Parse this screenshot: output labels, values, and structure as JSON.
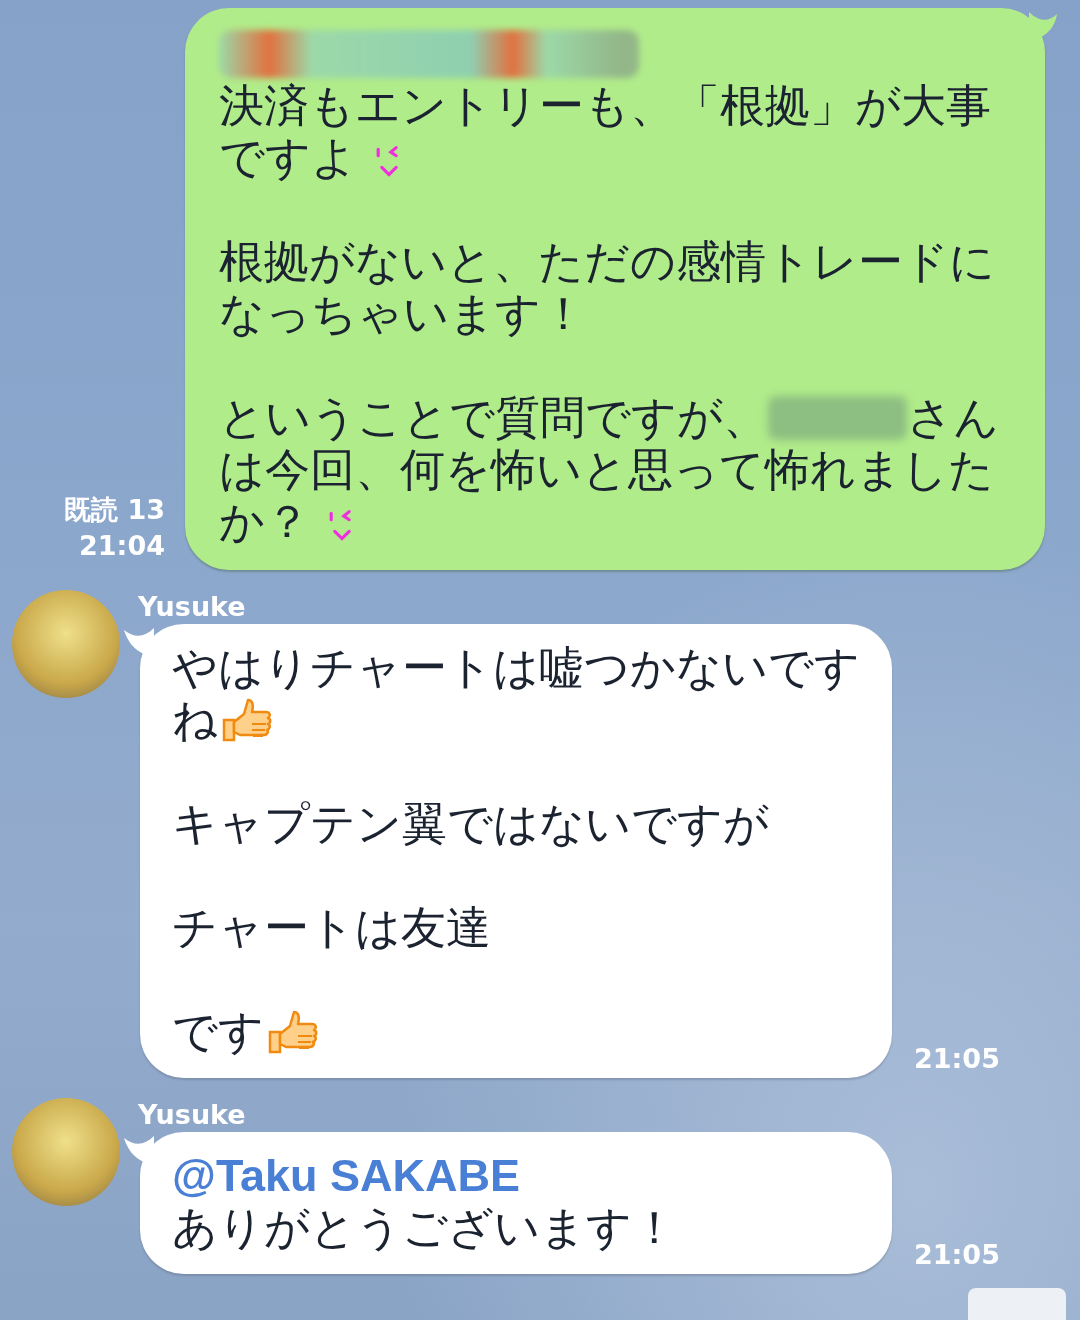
{
  "messages": [
    {
      "kind": "outgoing",
      "read": "既読 13",
      "time": "21:04",
      "paragraphs": [
        [
          [
            {
              "kind": "blurred_line"
            }
          ],
          [
            {
              "kind": "text",
              "text": "決済もエントリーも、「根拠」が大事"
            }
          ],
          [
            {
              "kind": "text",
              "text": "ですよ"
            },
            {
              "kind": "wink"
            }
          ]
        ],
        [
          [
            {
              "kind": "text",
              "text": "根拠がないと、ただの感情トレードに"
            }
          ],
          [
            {
              "kind": "text",
              "text": "なっちゃいます！"
            }
          ]
        ],
        [
          [
            {
              "kind": "text",
              "text": "ということで質問ですが、"
            },
            {
              "kind": "blurred_word"
            },
            {
              "kind": "text",
              "text": "さん"
            }
          ],
          [
            {
              "kind": "text",
              "text": "は今回、何を怖いと思って怖れました"
            }
          ],
          [
            {
              "kind": "text",
              "text": "か？"
            },
            {
              "kind": "wink"
            }
          ]
        ]
      ]
    },
    {
      "kind": "incoming",
      "sender": "Yusuke",
      "time": "21:05",
      "paragraphs": [
        [
          [
            {
              "kind": "text",
              "text": "やはりチャートは嘘つかないです"
            }
          ],
          [
            {
              "kind": "text",
              "text": "ね"
            },
            {
              "kind": "thumbs_up"
            }
          ]
        ],
        [
          [
            {
              "kind": "text",
              "text": "キャプテン翼ではないですが"
            }
          ]
        ],
        [
          [
            {
              "kind": "text",
              "text": "チャートは友達"
            }
          ]
        ],
        [
          [
            {
              "kind": "text",
              "text": "です"
            },
            {
              "kind": "thumbs_up"
            }
          ]
        ]
      ]
    },
    {
      "kind": "incoming",
      "sender": "Yusuke",
      "time": "21:05",
      "paragraphs": [
        [
          [
            {
              "kind": "mention",
              "text": "@Taku SAKABE"
            }
          ],
          [
            {
              "kind": "text",
              "text": "ありがとうございます！"
            }
          ]
        ]
      ]
    }
  ]
}
